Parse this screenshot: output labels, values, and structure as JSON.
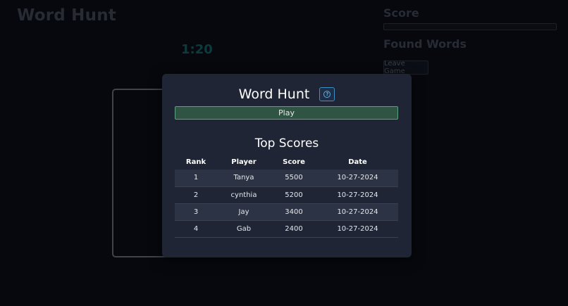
{
  "background": {
    "title": "Word Hunt",
    "timer": "1:20",
    "score_label": "Score",
    "found_words_label": "Found Words",
    "leave_button": "Leave Game"
  },
  "modal": {
    "title": "Word Hunt",
    "help_icon": "question-circle-icon",
    "help_glyph": "?",
    "play_button": "Play",
    "scores_title": "Top Scores",
    "columns": [
      "Rank",
      "Player",
      "Score",
      "Date"
    ],
    "rows": [
      {
        "rank": "1",
        "player": "Tanya",
        "score": "5500",
        "date": "10-27-2024"
      },
      {
        "rank": "2",
        "player": "cynthia",
        "score": "5200",
        "date": "10-27-2024"
      },
      {
        "rank": "3",
        "player": "Jay",
        "score": "3400",
        "date": "10-27-2024"
      },
      {
        "rank": "4",
        "player": "Gab",
        "score": "2400",
        "date": "10-27-2024"
      }
    ]
  },
  "colors": {
    "page_background": "#06080d",
    "modal_background": "#1f2535",
    "play_button": "#2f5444",
    "accent_help": "#3d8fc4"
  }
}
